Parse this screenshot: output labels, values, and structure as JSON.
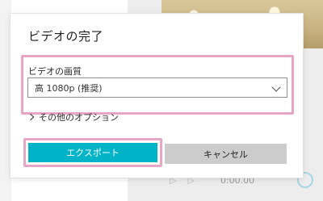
{
  "dialog": {
    "title": "ビデオの完了",
    "quality": {
      "label": "ビデオの画質",
      "selected": "高 1080p (推奨)"
    },
    "more_options": "その他のオプション",
    "export_label": "エクスポート",
    "cancel_label": "キャンセル"
  },
  "background": {
    "time": "0:00.00"
  },
  "colors": {
    "accent": "#00b3c6",
    "highlight": "#e8a6c6",
    "cancel_bg": "#cccccc"
  }
}
